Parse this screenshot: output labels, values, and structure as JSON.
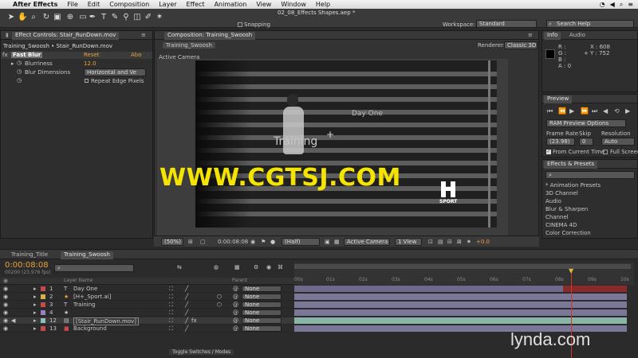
{
  "menubar": {
    "app": "After Effects",
    "items": [
      "File",
      "Edit",
      "Composition",
      "Layer",
      "Effect",
      "Animation",
      "View",
      "Window",
      "Help"
    ]
  },
  "toolbar": {
    "snapping": "Snapping",
    "doc_title": "02_08_Effects Shapes.aep *",
    "workspace_label": "Workspace:",
    "workspace_value": "Standard",
    "search_placeholder": "Search Help"
  },
  "effect_controls": {
    "tab": "Effect Controls: Stair_RunDown.mov",
    "breadcrumb": "Training_Swoosh • Stair_RunDown.mov",
    "effect_name": "Fast Blur",
    "reset": "Reset",
    "about": "Abo",
    "props": [
      {
        "name": "Blurriness",
        "value": "12.0"
      },
      {
        "name": "Blur Dimensions",
        "value": "Horizontal and Ve"
      },
      {
        "name": "Repeat Edge Pixels",
        "value": ""
      }
    ]
  },
  "composition": {
    "tab": "Composition: Training_Swoosh",
    "subtab": "Training_Swoosh",
    "renderer_label": "Renderer:",
    "renderer_value": "Classic 3D",
    "active_camera": "Active Camera",
    "overlay_day": "Day One",
    "overlay_training": "Training",
    "sport": "SPORT",
    "zoom": "(50%)",
    "timecode": "0:00:08:08",
    "resolution": "(Half)",
    "camera": "Active Camera",
    "view": "1 View",
    "exposure": "+0.0"
  },
  "info": {
    "tabs": [
      "Info",
      "Audio"
    ],
    "rgba": [
      "R :",
      "G :",
      "B :",
      "A : 0"
    ],
    "x": "X : 608",
    "y": "Y : 752"
  },
  "preview": {
    "tab": "Preview",
    "ram": "RAM Preview Options",
    "frame_rate_label": "Frame Rate",
    "skip_label": "Skip",
    "resolution_label": "Resolution",
    "frame_rate": "(23.98)",
    "skip": "0",
    "resolution": "Auto",
    "from_current": "From Current Time",
    "full_screen": "Full Screen"
  },
  "effects_presets": {
    "tab": "Effects & Presets",
    "items": [
      "* Animation Presets",
      "3D Channel",
      "Audio",
      "Blur & Sharpen",
      "Channel",
      "CINEMA 4D",
      "Color Correction"
    ]
  },
  "timeline": {
    "tabs": [
      "Training_Title",
      "Training_Swoosh"
    ],
    "timecode": "0:00:08:08",
    "frames": "00200 (23.976 fps)",
    "col_layer_name": "Layer Name",
    "col_parent": "Parent",
    "ruler": [
      "00s",
      "01s",
      "02s",
      "03s",
      "04s",
      "05s",
      "06s",
      "07s",
      "08s",
      "09s",
      "10s"
    ],
    "toggle": "Toggle Switches / Modes",
    "layers": [
      {
        "num": "1",
        "icon": "T",
        "name": "Day One",
        "parent": "None",
        "color": "#c64a4a"
      },
      {
        "num": "2",
        "icon": "★",
        "name": "[H+_Sport.ai]",
        "parent": "None",
        "color": "#d6b24a"
      },
      {
        "num": "3",
        "icon": "T",
        "name": "Training",
        "parent": "None",
        "color": "#c64a4a"
      },
      {
        "num": "4",
        "icon": "★",
        "name": "",
        "parent": "None",
        "color": "#9c7fc0"
      },
      {
        "num": "12",
        "icon": "▤",
        "name": "[Stair_RunDown.mov]",
        "parent": "None",
        "color": "#8fc0c0"
      },
      {
        "num": "13",
        "icon": "■",
        "name": "Background",
        "parent": "None",
        "color": "#c64a4a"
      }
    ]
  },
  "watermark": "WWW.CGTSJ.COM",
  "brand": "lynda.com"
}
